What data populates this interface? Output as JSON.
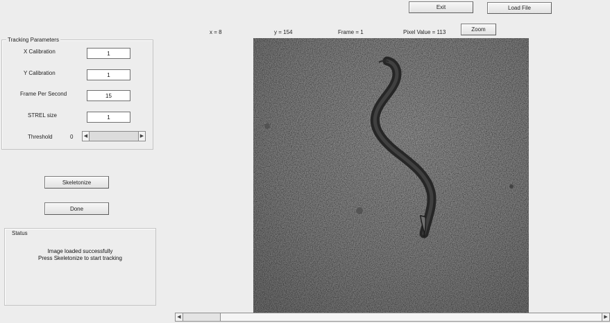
{
  "toolbar": {
    "exit_label": "Exit",
    "load_file_label": "Load File",
    "zoom_label": "Zoom"
  },
  "readouts": {
    "x": "x = 8",
    "y": "y = 154",
    "frame": "Frame = 1",
    "pixel_value": "Pixel Value = 113"
  },
  "tracking": {
    "title": "Tracking Parameters",
    "x_calibration": {
      "label": "X Calibration",
      "value": "1"
    },
    "y_calibration": {
      "label": "Y Calibration",
      "value": "1"
    },
    "fps": {
      "label": "Frame Per Second",
      "value": "15"
    },
    "strel": {
      "label": "STREL size",
      "value": "1"
    },
    "threshold": {
      "label": "Threshold",
      "value": "0"
    }
  },
  "actions": {
    "skeletonize_label": "Skeletonize",
    "done_label": "Done"
  },
  "status": {
    "title": "Status",
    "line1": "Image loaded successfully",
    "line2": "Press Skeletonize to start tracking"
  },
  "colors": {
    "window_bg": "#ededed",
    "image_bg": "#7d7d7d",
    "worm": "#2a2a2a"
  }
}
